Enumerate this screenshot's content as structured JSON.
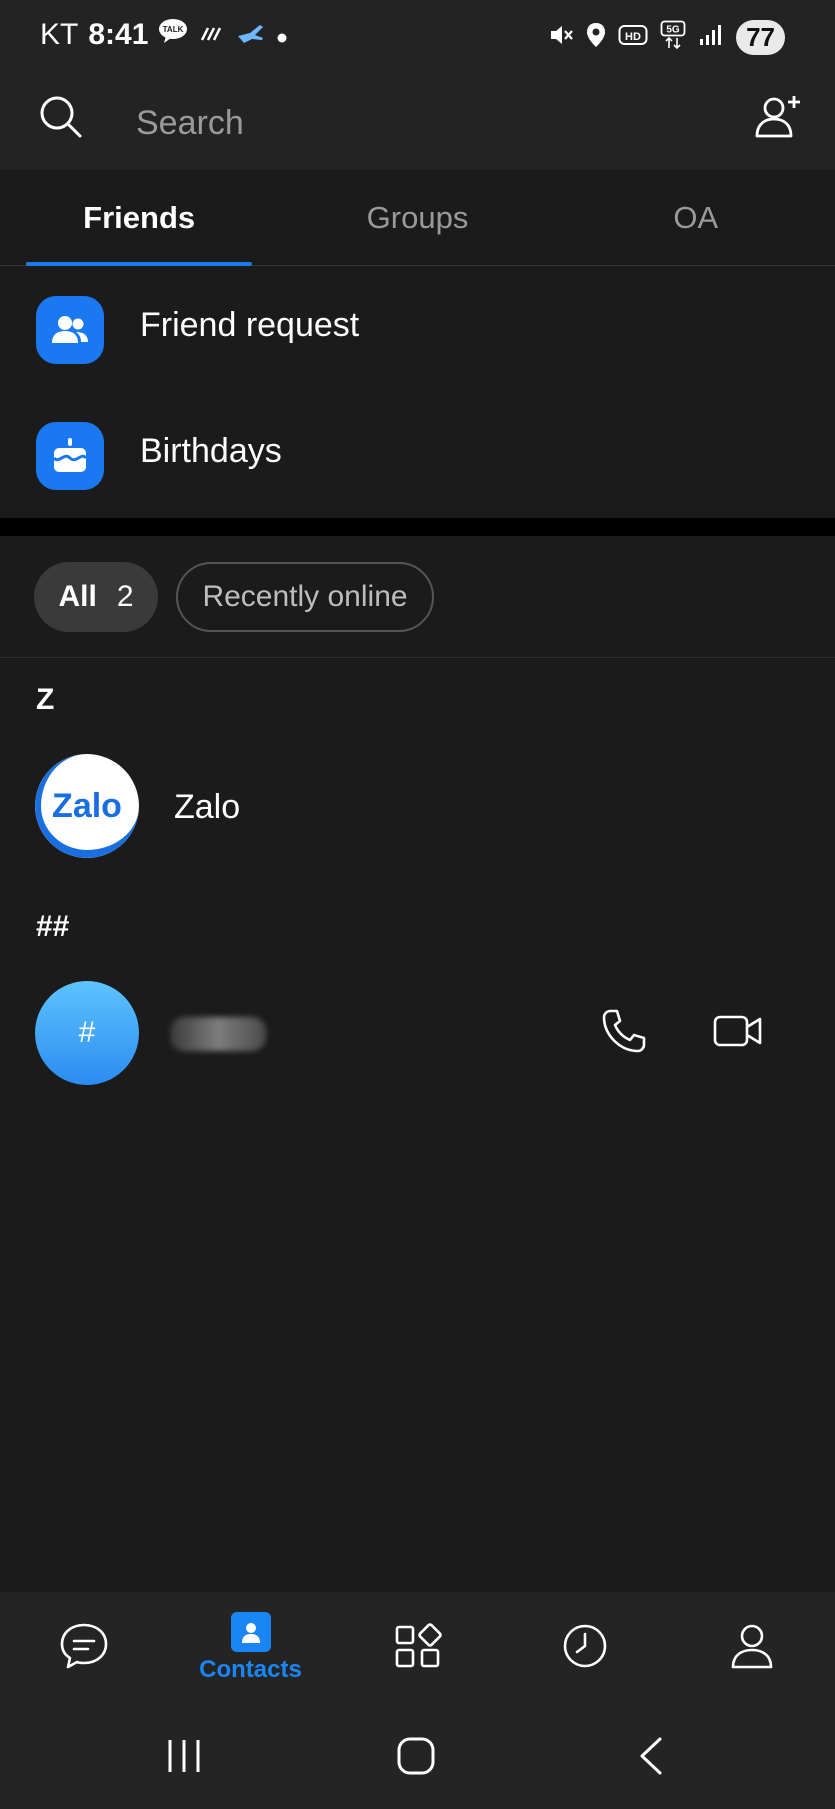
{
  "status_bar": {
    "carrier": "KT",
    "time": "8:41",
    "battery": "77"
  },
  "search": {
    "placeholder": "Search"
  },
  "tabs": [
    {
      "label": "Friends",
      "active": true
    },
    {
      "label": "Groups",
      "active": false
    },
    {
      "label": "OA",
      "active": false
    }
  ],
  "menu": {
    "friend_request": "Friend request",
    "birthdays": "Birthdays"
  },
  "filters": {
    "all_label": "All",
    "all_count": "2",
    "recent_label": "Recently online"
  },
  "sections": [
    {
      "header": "Z",
      "contacts": [
        {
          "name": "Zalo",
          "avatar_text": "Zalo"
        }
      ]
    },
    {
      "header": "##",
      "contacts": [
        {
          "avatar_text": "#"
        }
      ]
    }
  ],
  "bottom_nav": {
    "contacts_label": "Contacts",
    "active": "contacts"
  },
  "colors": {
    "accent": "#1a86f5",
    "background": "#1b1b1b",
    "panel": "#232323"
  }
}
